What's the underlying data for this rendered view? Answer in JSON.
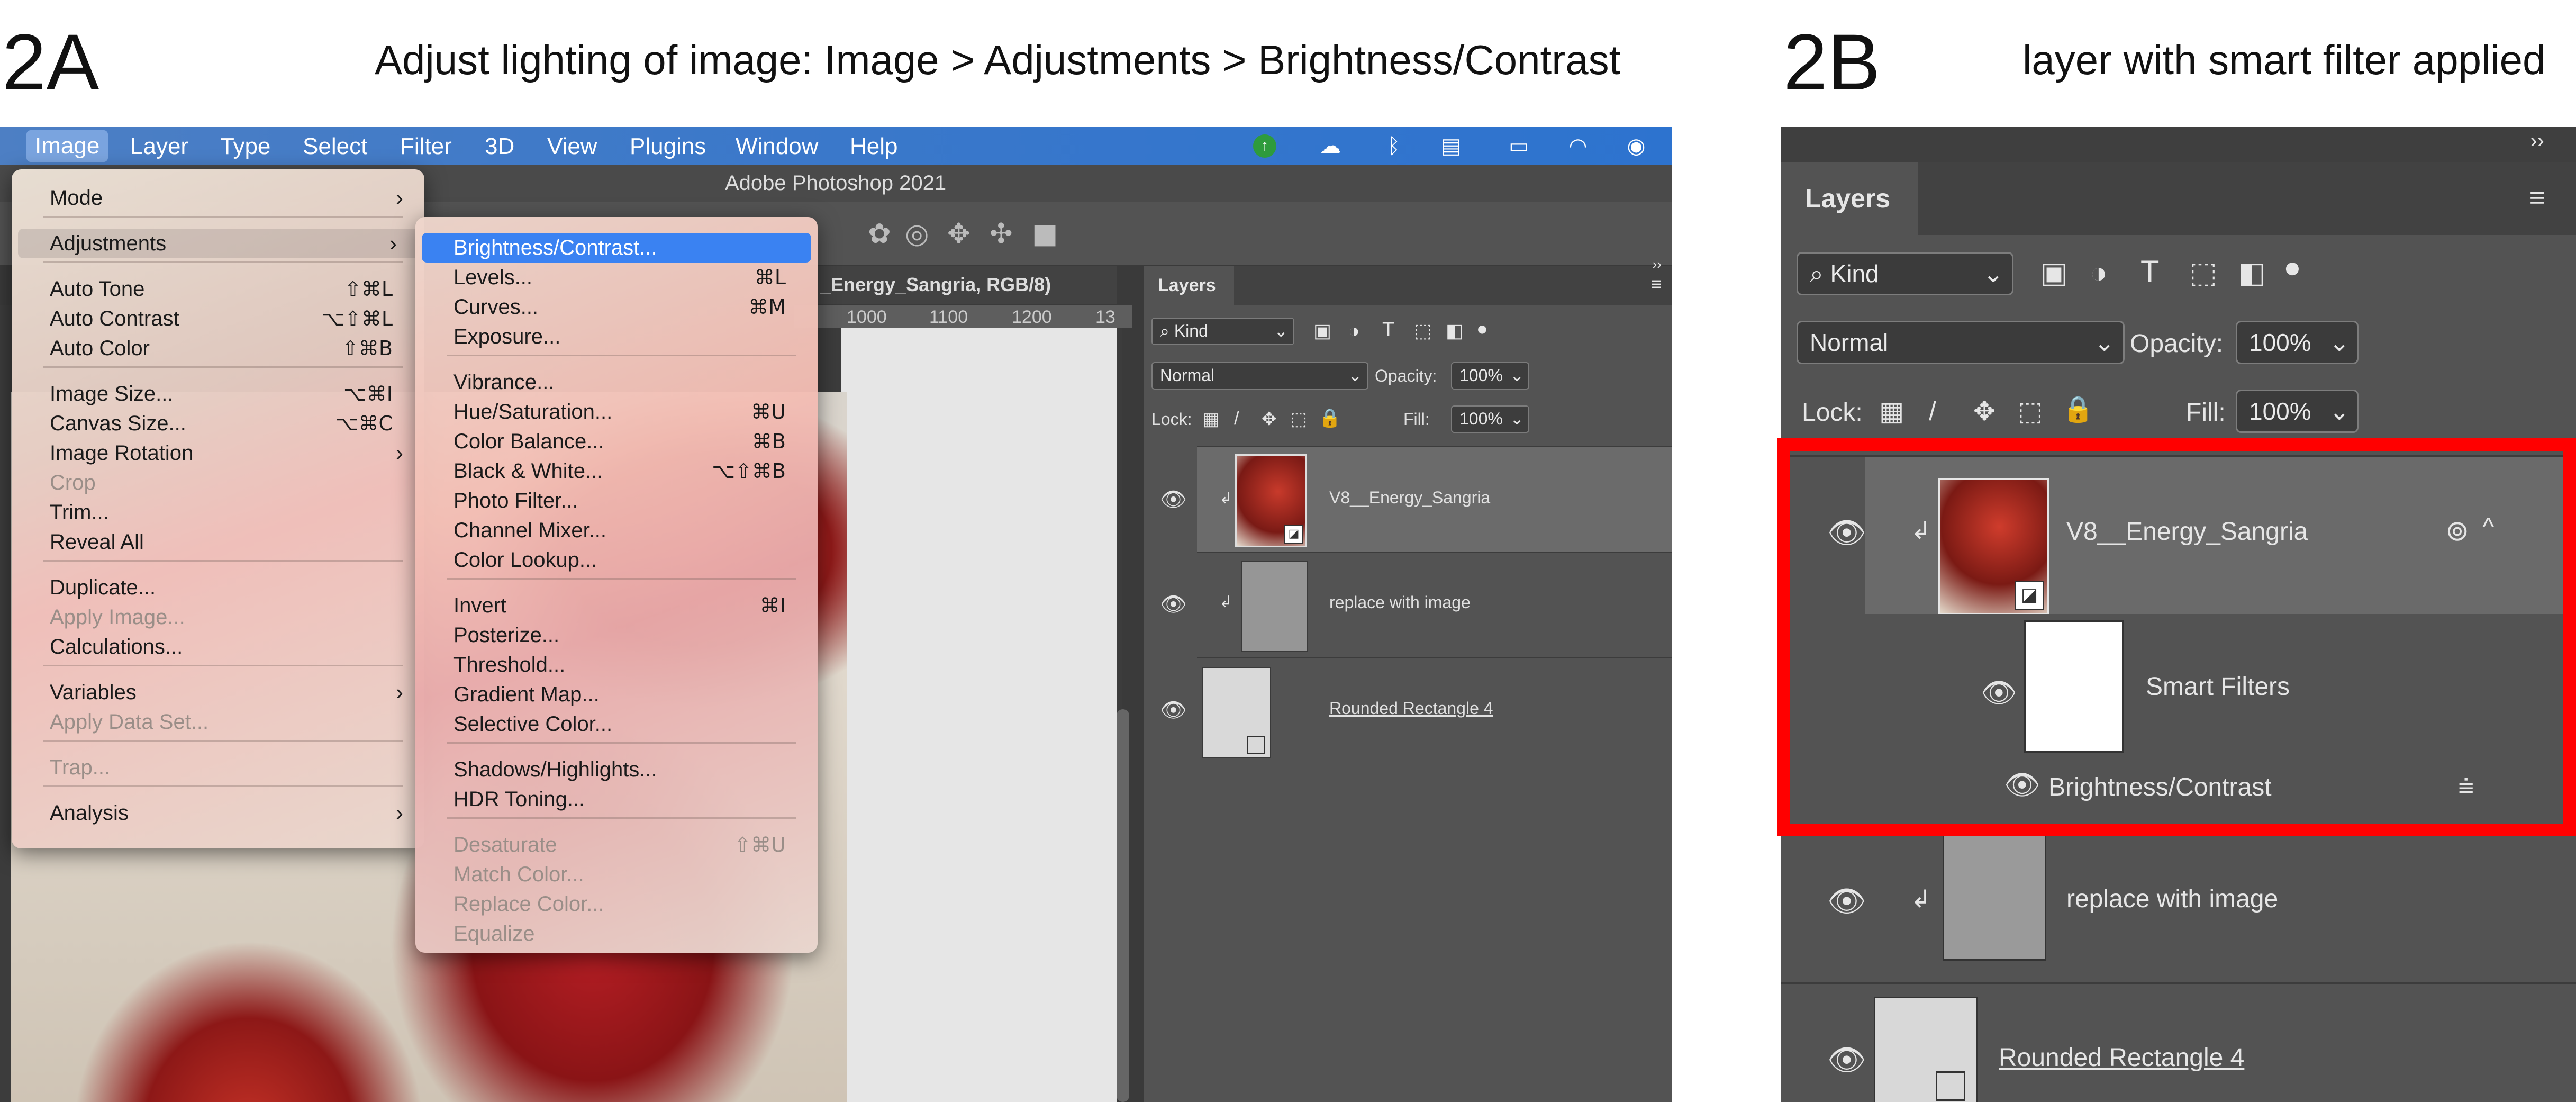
{
  "captions": {
    "a_label": "2A",
    "a_text": "Adjust lighting of image: Image > Adjustments > Brightness/Contrast",
    "b_label": "2B",
    "b_text": "layer with smart filter applied"
  },
  "menubar": {
    "items": [
      "Image",
      "Layer",
      "Type",
      "Select",
      "Filter",
      "3D",
      "View",
      "Plugins",
      "Window",
      "Help"
    ],
    "active": "Image"
  },
  "app_title": "Adobe Photoshop 2021",
  "document": {
    "tab_title": "_Energy_Sangria, RGB/8)",
    "ruler_ticks": [
      "1000",
      "1100",
      "1200",
      "13"
    ]
  },
  "image_menu": [
    {
      "label": "Mode",
      "submenu": true
    },
    {
      "label": "Adjustments",
      "submenu": true,
      "highlight": true
    },
    {
      "label": "Auto Tone",
      "shortcut": "⇧⌘L"
    },
    {
      "label": "Auto Contrast",
      "shortcut": "⌥⇧⌘L"
    },
    {
      "label": "Auto Color",
      "shortcut": "⇧⌘B"
    },
    {
      "label": "Image Size...",
      "shortcut": "⌥⌘I"
    },
    {
      "label": "Canvas Size...",
      "shortcut": "⌥⌘C"
    },
    {
      "label": "Image Rotation",
      "submenu": true
    },
    {
      "label": "Crop",
      "disabled": true
    },
    {
      "label": "Trim..."
    },
    {
      "label": "Reveal All"
    },
    {
      "label": "Duplicate..."
    },
    {
      "label": "Apply Image...",
      "disabled": true
    },
    {
      "label": "Calculations..."
    },
    {
      "label": "Variables",
      "submenu": true
    },
    {
      "label": "Apply Data Set...",
      "disabled": true
    },
    {
      "label": "Trap...",
      "disabled": true
    },
    {
      "label": "Analysis",
      "submenu": true
    }
  ],
  "adjustments_menu": [
    {
      "label": "Brightness/Contrast...",
      "selected": true
    },
    {
      "label": "Levels...",
      "shortcut": "⌘L"
    },
    {
      "label": "Curves...",
      "shortcut": "⌘M"
    },
    {
      "label": "Exposure..."
    },
    {
      "label": "Vibrance..."
    },
    {
      "label": "Hue/Saturation...",
      "shortcut": "⌘U"
    },
    {
      "label": "Color Balance...",
      "shortcut": "⌘B"
    },
    {
      "label": "Black & White...",
      "shortcut": "⌥⇧⌘B"
    },
    {
      "label": "Photo Filter..."
    },
    {
      "label": "Channel Mixer..."
    },
    {
      "label": "Color Lookup..."
    },
    {
      "label": "Invert",
      "shortcut": "⌘I"
    },
    {
      "label": "Posterize..."
    },
    {
      "label": "Threshold..."
    },
    {
      "label": "Gradient Map..."
    },
    {
      "label": "Selective Color..."
    },
    {
      "label": "Shadows/Highlights..."
    },
    {
      "label": "HDR Toning..."
    },
    {
      "label": "Desaturate",
      "shortcut": "⇧⌘U",
      "disabled": true
    },
    {
      "label": "Match Color...",
      "disabled": true
    },
    {
      "label": "Replace Color...",
      "disabled": true
    },
    {
      "label": "Equalize",
      "disabled": true
    }
  ],
  "layers_panel": {
    "tab": "Layers",
    "filter_kind": "Kind",
    "blend_mode": "Normal",
    "opacity_label": "Opacity:",
    "opacity": "100%",
    "lock_label": "Lock:",
    "fill_label": "Fill:",
    "fill": "100%",
    "layers": [
      {
        "name": "V8__Energy_Sangria",
        "selected": true
      },
      {
        "name": "replace with image"
      },
      {
        "name": "Rounded Rectangle 4"
      }
    ],
    "smart_filters_label": "Smart Filters",
    "smart_filter_name": "Brightness/Contrast"
  },
  "colors": {
    "menubar_blue": "#2d73cf",
    "highlight_blue": "#3a82f2",
    "panel_gray": "#535353",
    "annotation_red": "#ff0000"
  }
}
